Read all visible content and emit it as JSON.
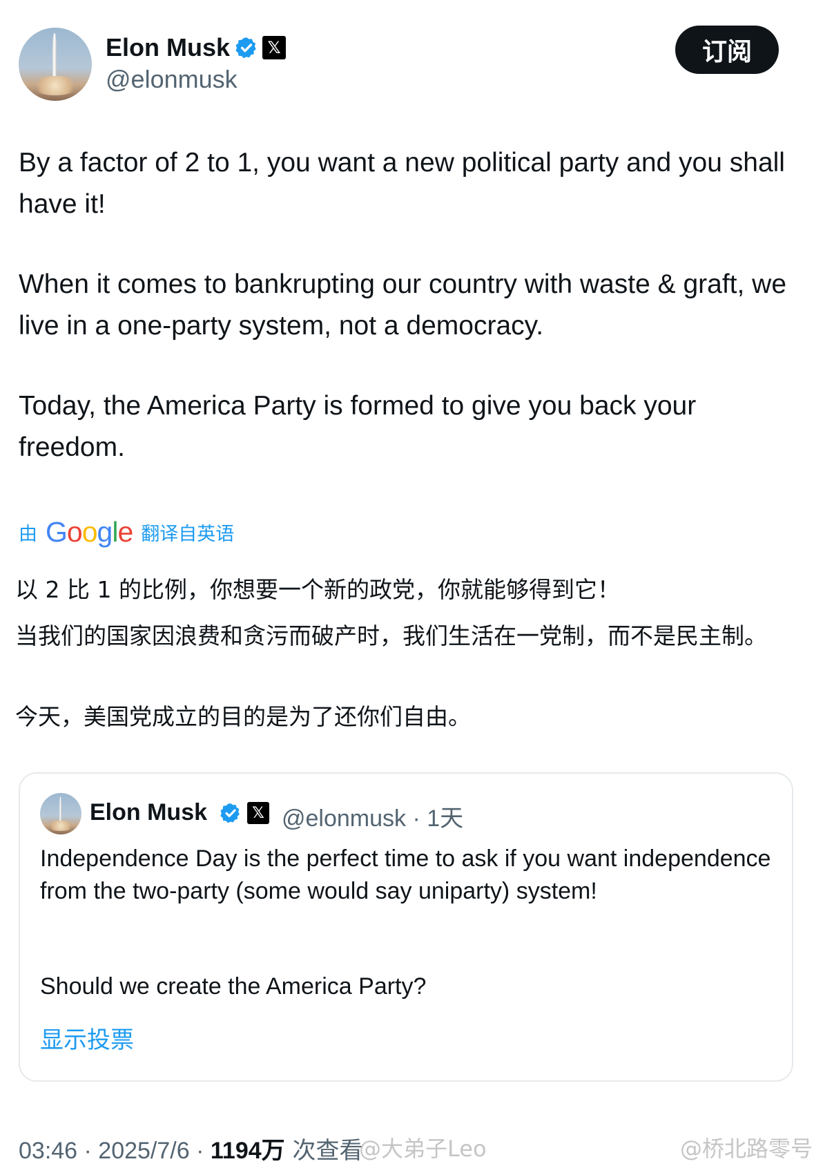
{
  "header": {
    "author_name": "Elon Musk",
    "author_handle": "@elonmusk",
    "subscribe_label": "订阅",
    "x_badge": "𝕏"
  },
  "tweet": {
    "paragraphs": [
      "By a factor of 2 to 1, you want a new political party and you shall have it!",
      "When it comes to bankrupting our country with waste & graft, we live in a one-party system, not a democracy.",
      "Today, the America Party is formed to give you back your freedom."
    ]
  },
  "translation": {
    "prefix": "由",
    "brand": [
      "G",
      "o",
      "o",
      "g",
      "l",
      "e"
    ],
    "brand_colors": [
      "#4285F4",
      "#EA4335",
      "#FBBC05",
      "#4285F4",
      "#34A853",
      "#EA4335"
    ],
    "suffix": "翻译自英语",
    "paragraphs": [
      "以 2 比 1 的比例，你想要一个新的政党，你就能够得到它！",
      "当我们的国家因浪费和贪污而破产时，我们生活在一党制，而不是民主制。",
      "今天，美国党成立的目的是为了还你们自由。"
    ]
  },
  "quoted": {
    "author_name": "Elon Musk",
    "handle_time": "@elonmusk · 1天",
    "text_1": "Independence Day is the perfect time to ask if you want independence from the two-party (some would say uniparty) system!",
    "text_2": "Should we create the America Party?",
    "show_poll": "显示投票"
  },
  "meta": {
    "time_date": "03:46 · 2025/7/6 · ",
    "views": "1194万",
    "views_label": " 次查看"
  },
  "watermarks": [
    "@大弟子Leo",
    "@桥北路零号"
  ],
  "colors": {
    "accent_blue": "#1d9bf0",
    "text_primary": "#0f1419",
    "text_secondary": "#536471",
    "subscribe_bg": "#0f1419"
  },
  "icons": [
    "verified-badge-icon",
    "x-logo-icon",
    "avatar-image",
    "weibo-logo-icon"
  ]
}
